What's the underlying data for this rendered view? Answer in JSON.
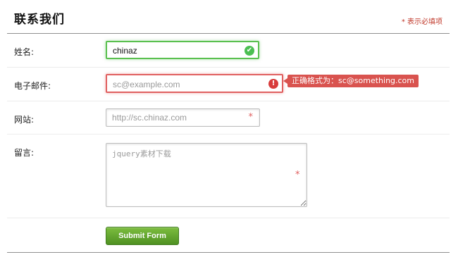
{
  "form": {
    "title": "联系我们",
    "required_note": "* 表示必填项",
    "fields": {
      "name": {
        "label": "姓名:",
        "value": "chinaz"
      },
      "email": {
        "label": "电子邮件:",
        "placeholder": "sc@example.com",
        "tooltip": "正确格式为：sc@something.com"
      },
      "website": {
        "label": "网站:",
        "placeholder": "http://sc.chinaz.com",
        "required_mark": "*"
      },
      "message": {
        "label": "留言:",
        "placeholder": "jquery素材下载",
        "required_mark": "*"
      }
    },
    "submit_label": "Submit Form"
  },
  "colors": {
    "valid": "#5ac04f",
    "invalid": "#e06060",
    "tooltip_bg": "#d9534f",
    "button": "#5c9f2b",
    "required_note": "#c0392b"
  },
  "icons": {
    "name_status": "check-circle-icon",
    "email_status": "exclamation-circle-icon"
  }
}
